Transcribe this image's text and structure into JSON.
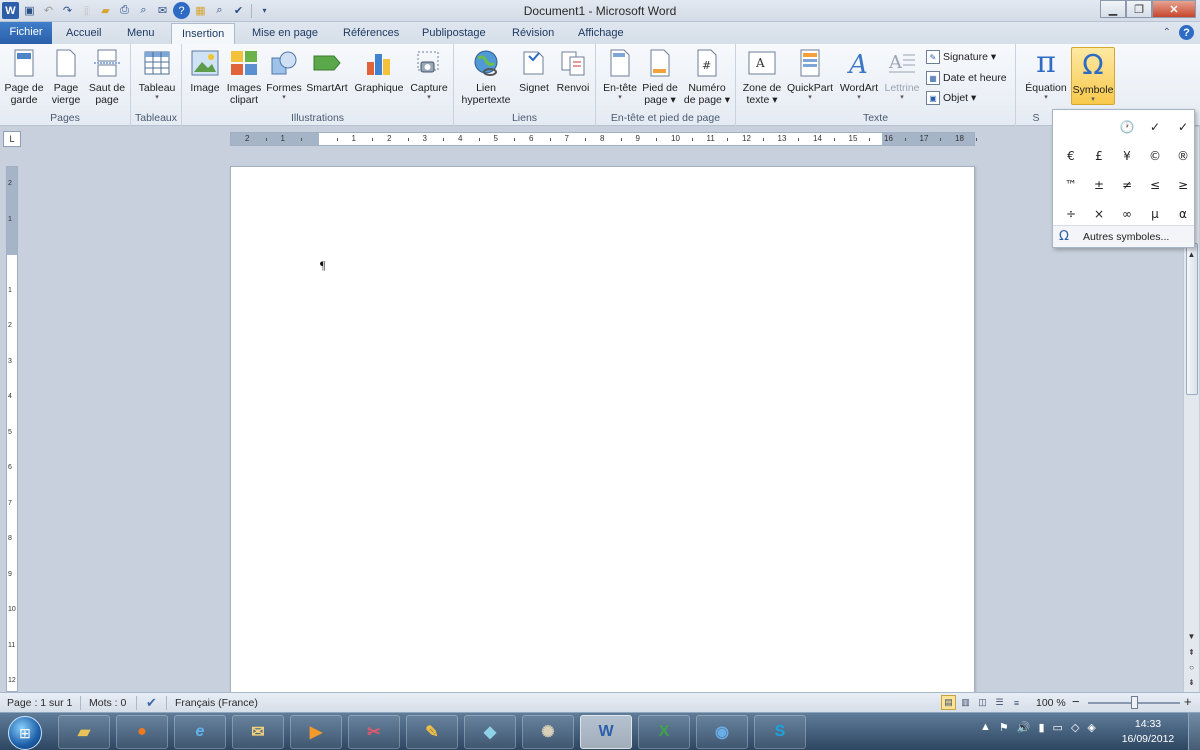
{
  "window": {
    "title": "Document1 - Microsoft Word"
  },
  "quick_access": [
    "word-app-icon",
    "save-icon",
    "undo-icon",
    "redo-icon",
    "new-document-icon",
    "open-icon",
    "print-icon",
    "print-preview-icon",
    "email-icon",
    "help-icon",
    "image-icon",
    "search-icon",
    "spelling-icon",
    "customize-icon"
  ],
  "tabs": {
    "file": "Fichier",
    "items": [
      "Accueil",
      "Menu",
      "Insertion",
      "Mise en page",
      "Références",
      "Publipostage",
      "Révision",
      "Affichage"
    ],
    "active": "Insertion"
  },
  "ribbon": {
    "pages": {
      "label": "Pages",
      "buttons": [
        {
          "l1": "Page de",
          "l2": "garde",
          "arrow": "▾"
        },
        {
          "l1": "Page",
          "l2": "vierge"
        },
        {
          "l1": "Saut de",
          "l2": "page"
        }
      ]
    },
    "tableaux": {
      "label": "Tableaux",
      "buttons": [
        {
          "l1": "Tableau",
          "l2": "▾"
        }
      ]
    },
    "illustrations": {
      "label": "Illustrations",
      "buttons": [
        {
          "l1": "Image"
        },
        {
          "l1": "Images",
          "l2": "clipart"
        },
        {
          "l1": "Formes",
          "l2": "▾"
        },
        {
          "l1": "SmartArt"
        },
        {
          "l1": "Graphique"
        },
        {
          "l1": "Capture",
          "l2": "▾"
        }
      ]
    },
    "liens": {
      "label": "Liens",
      "buttons": [
        {
          "l1": "Lien",
          "l2": "hypertexte"
        },
        {
          "l1": "Signet"
        },
        {
          "l1": "Renvoi"
        }
      ]
    },
    "entete": {
      "label": "En-tête et pied de page",
      "buttons": [
        {
          "l1": "En-tête",
          "l2": "▾"
        },
        {
          "l1": "Pied de",
          "l2": "page ▾"
        },
        {
          "l1": "Numéro",
          "l2": "de page ▾"
        }
      ]
    },
    "texte": {
      "label": "Texte",
      "buttons": [
        {
          "l1": "Zone de",
          "l2": "texte ▾"
        },
        {
          "l1": "QuickPart",
          "l2": "▾"
        },
        {
          "l1": "WordArt",
          "l2": "▾"
        },
        {
          "l1": "Lettrine",
          "l2": "▾"
        }
      ],
      "small": [
        "Signature ▾",
        "Date et heure",
        "Objet ▾"
      ]
    },
    "symboles": {
      "label": "S",
      "buttons": [
        {
          "l1": "Équation",
          "l2": "▾"
        },
        {
          "l1": "Symbole",
          "l2": "▾"
        }
      ]
    }
  },
  "ruler": {
    "numbers": [
      "2",
      "1",
      "1",
      "2",
      "3",
      "4",
      "5",
      "6",
      "7",
      "8",
      "9",
      "10",
      "11",
      "12",
      "13",
      "14",
      "15",
      "16",
      "17",
      "18"
    ],
    "vnumbers": [
      "2",
      "1",
      "1",
      "2",
      "3",
      "4",
      "5",
      "6",
      "7",
      "8",
      "9",
      "10",
      "11",
      "12",
      "13",
      "14"
    ]
  },
  "document": {
    "pilcrow": "¶"
  },
  "symbol_menu": {
    "symbols": [
      "",
      "",
      "🕐",
      "✓",
      "✓",
      "€",
      "£",
      "¥",
      "©",
      "®",
      "™",
      "±",
      "≠",
      "≤",
      "≥",
      "÷",
      "×",
      "∞",
      "µ",
      "α"
    ],
    "more_icon": "Ω",
    "more_label": "Autres symboles..."
  },
  "status": {
    "page": "Page : 1 sur 1",
    "words": "Mots : 0",
    "language": "Français (France)",
    "zoom": "100 %",
    "zoom_minus": "−",
    "zoom_plus": "+"
  },
  "taskbar": {
    "apps": [
      "file-explorer",
      "firefox",
      "internet-explorer",
      "outlook",
      "media-player",
      "paint-brush-app",
      "paint-app",
      "notes-app",
      "gimp",
      "word",
      "excel",
      "thunderbird",
      "skype"
    ],
    "active_app": "word",
    "time": "14:33",
    "date": "16/09/2012"
  },
  "colors": {
    "file_tab": "#2b5fa9",
    "selected_button": "#f8c94c",
    "accent": "#2d6bc4"
  }
}
